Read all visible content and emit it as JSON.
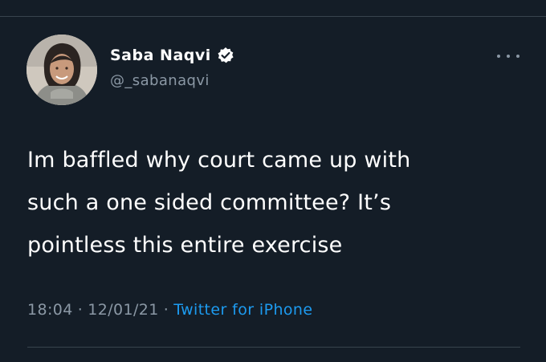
{
  "tweet": {
    "author": {
      "display_name": "Saba Naqvi",
      "handle": "@_sabanaqvi",
      "verified": true
    },
    "text": "Im baffled why court came up with\nsuch a one sided committee? It’s\npointless this entire exercise",
    "time": "18:04",
    "date": "12/01/21",
    "separator": "·",
    "source": "Twitter for iPhone"
  },
  "colors": {
    "background": "#141d27",
    "text": "#ffffff",
    "muted": "#8b98a5",
    "link": "#1d9bf0",
    "divider": "#38444d"
  },
  "icons": {
    "verified": "verified-badge-icon",
    "more": "more-options-icon"
  }
}
